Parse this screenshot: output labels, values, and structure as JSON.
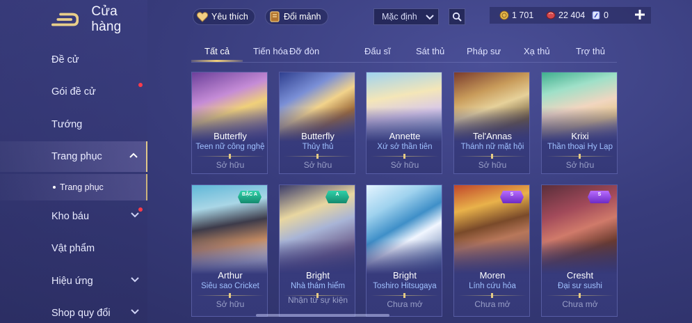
{
  "sidebar": {
    "title": "Cửa hàng",
    "items": [
      {
        "label": "Đề cử"
      },
      {
        "label": "Gói đề cử"
      },
      {
        "label": "Tướng"
      },
      {
        "label": "Trang phục"
      },
      {
        "label": "Kho báu"
      },
      {
        "label": "Vật phẩm"
      },
      {
        "label": "Hiệu ứng"
      },
      {
        "label": "Shop quy đổi"
      }
    ],
    "sub_item": "Trang phục"
  },
  "topbar": {
    "favorite_label": "Yêu thích",
    "shards_label": "Đổi mảnh",
    "sort_selected": "Mặc định"
  },
  "currency": {
    "gold": "1 701",
    "vouchers": "22 404",
    "gems": "0"
  },
  "tabs": [
    {
      "label": "Tất cả"
    },
    {
      "label": "Tiến hóa"
    },
    {
      "label": "Đỡ đòn"
    },
    {
      "label": "Đấu sĩ"
    },
    {
      "label": "Sát thủ"
    },
    {
      "label": "Pháp sư"
    },
    {
      "label": "Xạ thủ"
    },
    {
      "label": "Trợ thủ"
    }
  ],
  "cards": [
    {
      "hero": "Butterfly",
      "skin": "Teen nữ công nghệ",
      "status": "Sở hữu"
    },
    {
      "hero": "Butterfly",
      "skin": "Thủy thủ",
      "status": "Sở hữu"
    },
    {
      "hero": "Annette",
      "skin": "Xứ sở thần tiên",
      "status": "Sở hữu"
    },
    {
      "hero": "Tel'Annas",
      "skin": "Thánh nữ mặt hội",
      "status": "Sở hữu"
    },
    {
      "hero": "Krixi",
      "skin": "Thần thoại Hy Lạp",
      "status": "Sở hữu"
    },
    {
      "hero": "Arthur",
      "skin": "Siêu sao Cricket",
      "status": "Sở hữu",
      "badge": "BẬC A"
    },
    {
      "hero": "Bright",
      "skin": "Nhà thám hiểm",
      "status": "Nhận từ sự kiện",
      "badge": "A"
    },
    {
      "hero": "Bright",
      "skin": "Toshiro Hitsugaya",
      "status": "Chưa mở"
    },
    {
      "hero": "Moren",
      "skin": "Lính cứu hỏa",
      "status": "Chưa mở",
      "badge": "S"
    },
    {
      "hero": "Cresht",
      "skin": "Đại sư sushi",
      "status": "Chưa mở",
      "badge": "S"
    }
  ],
  "colors": {
    "background": "#383c7c",
    "accent_gold": "#f0cf7c",
    "skin_name": "#9fc0ff",
    "notification_dot": "#ff3b4a"
  }
}
